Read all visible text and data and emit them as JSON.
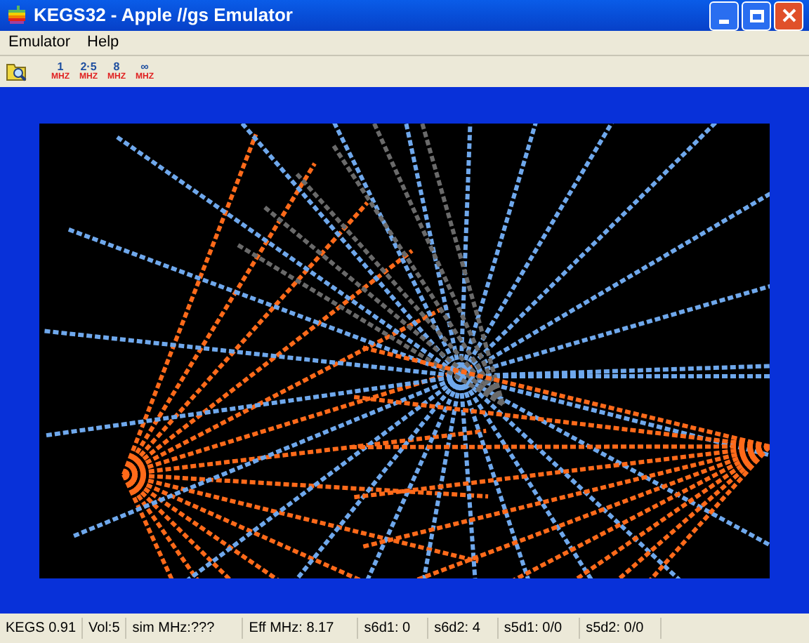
{
  "window": {
    "title": "KEGS32 - Apple //gs Emulator"
  },
  "menu": [
    "Emulator",
    "Help"
  ],
  "speed_buttons": [
    {
      "speed": "1",
      "unit": "MHZ"
    },
    {
      "speed": "2·5",
      "unit": "MHZ"
    },
    {
      "speed": "8",
      "unit": "MHZ"
    },
    {
      "speed": "∞",
      "unit": "MHZ"
    }
  ],
  "status_bar": [
    "KEGS 0.91",
    "Vol:5",
    "sim MHz:???",
    "Eff MHz:  8.17",
    "s6d1: 0",
    "s6d2: 4",
    "s5d1: 0/0",
    "s5d2: 0/0"
  ]
}
